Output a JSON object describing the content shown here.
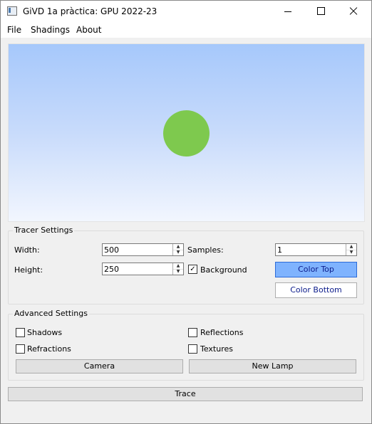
{
  "window": {
    "title": "GiVD 1a pràctica: GPU 2022-23"
  },
  "menu": [
    "File",
    "Shadings",
    "About"
  ],
  "viewport": {
    "sky_top": "#a6c8fb",
    "sky_bottom": "#f2f6fe",
    "sphere_color": "#7ec94e"
  },
  "tracer": {
    "title": "Tracer Settings",
    "width_label": "Width:",
    "width_value": "500",
    "height_label": "Height:",
    "height_value": "250",
    "samples_label": "Samples:",
    "samples_value": "1",
    "background_label": "Background",
    "background_checked": true,
    "color_top_label": "Color Top",
    "color_top": "#7fb3fe",
    "color_bottom_label": "Color Bottom"
  },
  "advanced": {
    "title": "Advanced Settings",
    "shadows_label": "Shadows",
    "reflections_label": "Reflections",
    "refractions_label": "Refractions",
    "textures_label": "Textures",
    "camera_label": "Camera",
    "new_lamp_label": "New Lamp"
  },
  "trace_label": "Trace"
}
